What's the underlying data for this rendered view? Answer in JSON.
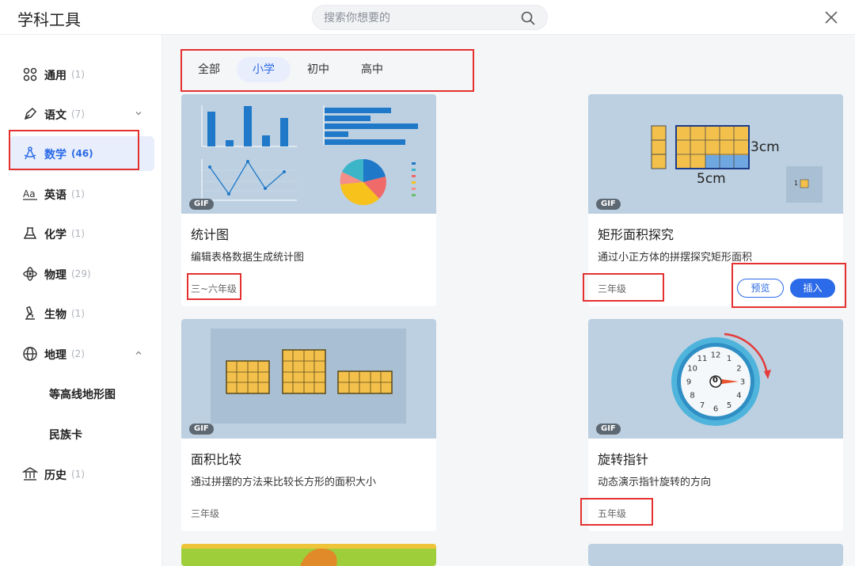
{
  "header": {
    "title": "学科工具",
    "search_placeholder": "搜索你想要的"
  },
  "sidebar": {
    "items": [
      {
        "label": "通用",
        "count": "(1)",
        "icon": "grid-icon"
      },
      {
        "label": "语文",
        "count": "(7)",
        "icon": "pen-icon",
        "chevron": "chevron-down-icon"
      },
      {
        "label": "数学",
        "count": "(46)",
        "icon": "compass-icon",
        "active": true
      },
      {
        "label": "英语",
        "count": "(1)",
        "icon": "aa-icon"
      },
      {
        "label": "化学",
        "count": "(1)",
        "icon": "flask-icon"
      },
      {
        "label": "物理",
        "count": "(29)",
        "icon": "atom-icon"
      },
      {
        "label": "生物",
        "count": "(1)",
        "icon": "microscope-icon"
      },
      {
        "label": "地理",
        "count": "(2)",
        "icon": "globe-icon",
        "chevron": "chevron-up-icon"
      },
      {
        "label": "历史",
        "count": "(1)",
        "icon": "museum-icon"
      }
    ],
    "sub_items": [
      "等高线地形图",
      "民族卡"
    ]
  },
  "tabs": [
    "全部",
    "小学",
    "初中",
    "高中"
  ],
  "active_tab": "小学",
  "badge": "GIF",
  "cards": [
    {
      "title": "统计图",
      "desc": "编辑表格数据生成统计图",
      "grade": "三~六年级"
    },
    {
      "title": "矩形面积探究",
      "desc": "通过小正方体的拼摆探究矩形面积",
      "grade": "三年级",
      "preview": "预览",
      "insert": "插入",
      "dims": {
        "h": "3cm",
        "w": "5cm",
        "unit": "1"
      }
    },
    {
      "title": "面积比较",
      "desc": "通过拼摆的方法来比较长方形的面积大小",
      "grade": "三年级"
    },
    {
      "title": "旋转指针",
      "desc": "动态演示指针旋转的方向",
      "grade": "五年级",
      "clock": [
        "12",
        "1",
        "2",
        "3",
        "4",
        "5",
        "6",
        "7",
        "8",
        "9",
        "10",
        "11"
      ],
      "center": "0"
    }
  ],
  "colors": {
    "accent": "#2b6ae8",
    "highlight": "#e53030",
    "thumb_bg": "#bcd0e1",
    "bar": "#1f78c8",
    "tile": "#f3c04b"
  }
}
